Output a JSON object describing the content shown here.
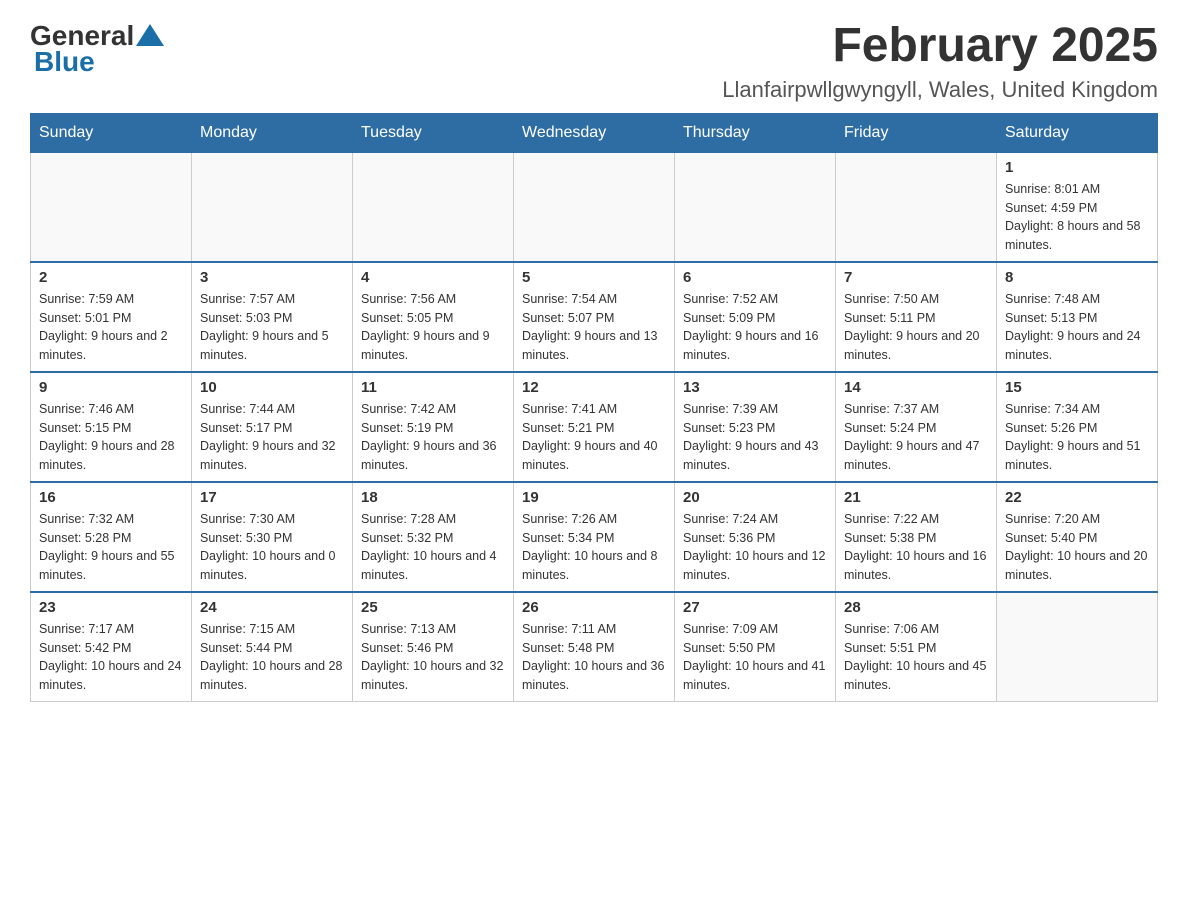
{
  "header": {
    "logo_general": "General",
    "logo_blue": "Blue",
    "month_title": "February 2025",
    "location": "Llanfairpwllgwyngyll, Wales, United Kingdom"
  },
  "days_of_week": [
    "Sunday",
    "Monday",
    "Tuesday",
    "Wednesday",
    "Thursday",
    "Friday",
    "Saturday"
  ],
  "weeks": [
    [
      {
        "day": "",
        "info": ""
      },
      {
        "day": "",
        "info": ""
      },
      {
        "day": "",
        "info": ""
      },
      {
        "day": "",
        "info": ""
      },
      {
        "day": "",
        "info": ""
      },
      {
        "day": "",
        "info": ""
      },
      {
        "day": "1",
        "info": "Sunrise: 8:01 AM\nSunset: 4:59 PM\nDaylight: 8 hours and 58 minutes."
      }
    ],
    [
      {
        "day": "2",
        "info": "Sunrise: 7:59 AM\nSunset: 5:01 PM\nDaylight: 9 hours and 2 minutes."
      },
      {
        "day": "3",
        "info": "Sunrise: 7:57 AM\nSunset: 5:03 PM\nDaylight: 9 hours and 5 minutes."
      },
      {
        "day": "4",
        "info": "Sunrise: 7:56 AM\nSunset: 5:05 PM\nDaylight: 9 hours and 9 minutes."
      },
      {
        "day": "5",
        "info": "Sunrise: 7:54 AM\nSunset: 5:07 PM\nDaylight: 9 hours and 13 minutes."
      },
      {
        "day": "6",
        "info": "Sunrise: 7:52 AM\nSunset: 5:09 PM\nDaylight: 9 hours and 16 minutes."
      },
      {
        "day": "7",
        "info": "Sunrise: 7:50 AM\nSunset: 5:11 PM\nDaylight: 9 hours and 20 minutes."
      },
      {
        "day": "8",
        "info": "Sunrise: 7:48 AM\nSunset: 5:13 PM\nDaylight: 9 hours and 24 minutes."
      }
    ],
    [
      {
        "day": "9",
        "info": "Sunrise: 7:46 AM\nSunset: 5:15 PM\nDaylight: 9 hours and 28 minutes."
      },
      {
        "day": "10",
        "info": "Sunrise: 7:44 AM\nSunset: 5:17 PM\nDaylight: 9 hours and 32 minutes."
      },
      {
        "day": "11",
        "info": "Sunrise: 7:42 AM\nSunset: 5:19 PM\nDaylight: 9 hours and 36 minutes."
      },
      {
        "day": "12",
        "info": "Sunrise: 7:41 AM\nSunset: 5:21 PM\nDaylight: 9 hours and 40 minutes."
      },
      {
        "day": "13",
        "info": "Sunrise: 7:39 AM\nSunset: 5:23 PM\nDaylight: 9 hours and 43 minutes."
      },
      {
        "day": "14",
        "info": "Sunrise: 7:37 AM\nSunset: 5:24 PM\nDaylight: 9 hours and 47 minutes."
      },
      {
        "day": "15",
        "info": "Sunrise: 7:34 AM\nSunset: 5:26 PM\nDaylight: 9 hours and 51 minutes."
      }
    ],
    [
      {
        "day": "16",
        "info": "Sunrise: 7:32 AM\nSunset: 5:28 PM\nDaylight: 9 hours and 55 minutes."
      },
      {
        "day": "17",
        "info": "Sunrise: 7:30 AM\nSunset: 5:30 PM\nDaylight: 10 hours and 0 minutes."
      },
      {
        "day": "18",
        "info": "Sunrise: 7:28 AM\nSunset: 5:32 PM\nDaylight: 10 hours and 4 minutes."
      },
      {
        "day": "19",
        "info": "Sunrise: 7:26 AM\nSunset: 5:34 PM\nDaylight: 10 hours and 8 minutes."
      },
      {
        "day": "20",
        "info": "Sunrise: 7:24 AM\nSunset: 5:36 PM\nDaylight: 10 hours and 12 minutes."
      },
      {
        "day": "21",
        "info": "Sunrise: 7:22 AM\nSunset: 5:38 PM\nDaylight: 10 hours and 16 minutes."
      },
      {
        "day": "22",
        "info": "Sunrise: 7:20 AM\nSunset: 5:40 PM\nDaylight: 10 hours and 20 minutes."
      }
    ],
    [
      {
        "day": "23",
        "info": "Sunrise: 7:17 AM\nSunset: 5:42 PM\nDaylight: 10 hours and 24 minutes."
      },
      {
        "day": "24",
        "info": "Sunrise: 7:15 AM\nSunset: 5:44 PM\nDaylight: 10 hours and 28 minutes."
      },
      {
        "day": "25",
        "info": "Sunrise: 7:13 AM\nSunset: 5:46 PM\nDaylight: 10 hours and 32 minutes."
      },
      {
        "day": "26",
        "info": "Sunrise: 7:11 AM\nSunset: 5:48 PM\nDaylight: 10 hours and 36 minutes."
      },
      {
        "day": "27",
        "info": "Sunrise: 7:09 AM\nSunset: 5:50 PM\nDaylight: 10 hours and 41 minutes."
      },
      {
        "day": "28",
        "info": "Sunrise: 7:06 AM\nSunset: 5:51 PM\nDaylight: 10 hours and 45 minutes."
      },
      {
        "day": "",
        "info": ""
      }
    ]
  ]
}
